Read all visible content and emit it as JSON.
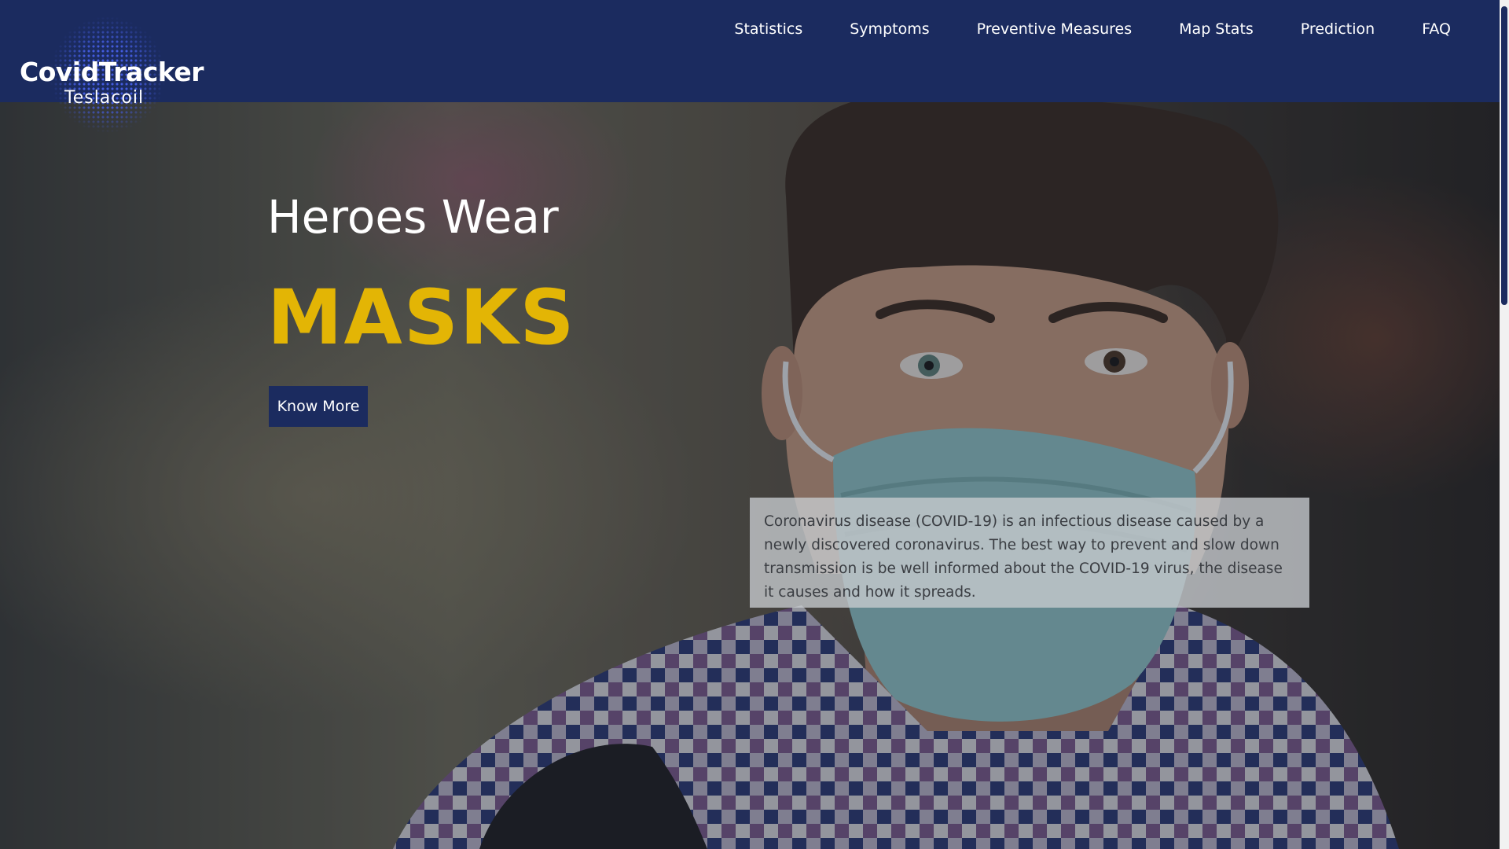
{
  "brand": {
    "title": "CovidTracker",
    "subtitle": "Teslacoil"
  },
  "nav": {
    "items": [
      {
        "label": "Statistics"
      },
      {
        "label": "Symptoms"
      },
      {
        "label": "Preventive Measures"
      },
      {
        "label": "Map Stats"
      },
      {
        "label": "Prediction"
      },
      {
        "label": "FAQ"
      }
    ]
  },
  "hero": {
    "heading": "Heroes Wear",
    "highlight": "MASKS",
    "button_label": "Know More",
    "description": "Coronavirus disease (COVID-19) is an infectious disease caused by a newly discovered coronavirus. The best way to prevent and slow down transmission is be well informed about the COVID-19 virus, the disease it causes and how it spreads."
  },
  "colors": {
    "navbar": "#1b2b5f",
    "highlight": "#e3b505",
    "button": "#1b2b5f",
    "text_light": "#ffffff"
  }
}
